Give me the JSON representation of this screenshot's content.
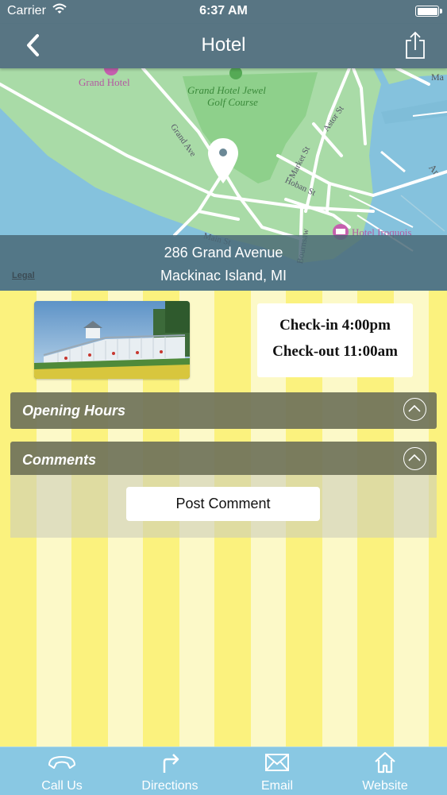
{
  "status_bar": {
    "carrier": "Carrier",
    "time": "6:37 AM"
  },
  "nav": {
    "title": "Hotel",
    "back_icon": "chevron-left-icon",
    "share_icon": "share-icon"
  },
  "map": {
    "labels": {
      "grand_hotel": "Grand Hotel",
      "golf_line1": "Grand Hotel Jewel",
      "golf_line2": "Golf Course",
      "grand_ave": "Grand Ave",
      "astor_st": "Astor St",
      "market_st": "Market St",
      "hoban_st": "Hoban St",
      "main_st": "Main St",
      "bournsaw": "Bournsaw",
      "hotel_iroquois": "Hotel Iroquois",
      "edge_ma": "Ma",
      "edge_ar": "Ar"
    },
    "address_line1": "286 Grand Avenue",
    "address_line2": "Mackinac Island, MI",
    "legal": "Legal"
  },
  "hotel_info": {
    "checkin": "Check-in 4:00pm",
    "checkout": "Check-out 11:00am"
  },
  "sections": {
    "opening_hours": "Opening Hours",
    "comments": "Comments",
    "post_comment": "Post Comment"
  },
  "tabs": [
    {
      "label": "Call Us",
      "icon": "phone-icon"
    },
    {
      "label": "Directions",
      "icon": "directions-arrow-icon"
    },
    {
      "label": "Email",
      "icon": "envelope-icon"
    },
    {
      "label": "Website",
      "icon": "home-icon"
    }
  ],
  "colors": {
    "bar": "#587583",
    "stripe_yellow": "#fbf27e",
    "stripe_light": "#fcf9c8",
    "tab_bar": "#89c8e3",
    "section_header": "#70735a"
  }
}
